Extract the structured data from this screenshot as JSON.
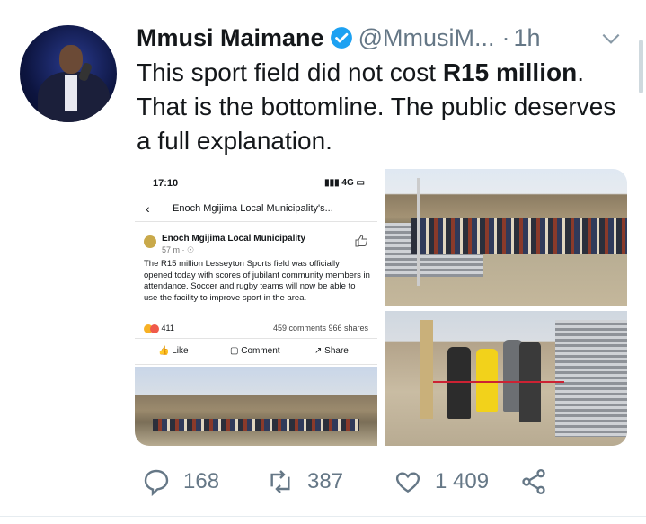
{
  "tweet": {
    "author_name": "Mmusi Maimane",
    "handle": "@MmusiM...",
    "separator": "·",
    "time": "1h",
    "text_line1_a": "This sport field did not cost ",
    "text_line1_b": "R15 million",
    "text_line1_c": ".",
    "text_rest": "That is the bottomline. The public deserves a full explanation."
  },
  "embedded_post": {
    "status_time": "17:10",
    "status_signal": "4G",
    "nav_title": "Enoch Mgijima Local Municipality's...",
    "page_name": "Enoch Mgijima Local Municipality",
    "post_meta": "57 m · ☉",
    "body": "The R15 million Lesseyton Sports field was officially opened today with scores of jubilant community members in attendance. Soccer and rugby teams will now be able to use the facility to improve sport in the area.",
    "reactions": "411",
    "counts": "459 comments  966 shares",
    "like": "Like",
    "comment": "Comment",
    "share": "Share"
  },
  "actions": {
    "replies": "168",
    "retweets": "387",
    "likes": "1 409"
  },
  "colors": {
    "verified": "#1da1f2",
    "secondary_text": "#657786"
  },
  "icons": [
    "verified-badge-icon",
    "chevron-down-icon",
    "reply-icon",
    "retweet-icon",
    "like-icon",
    "share-icon"
  ]
}
